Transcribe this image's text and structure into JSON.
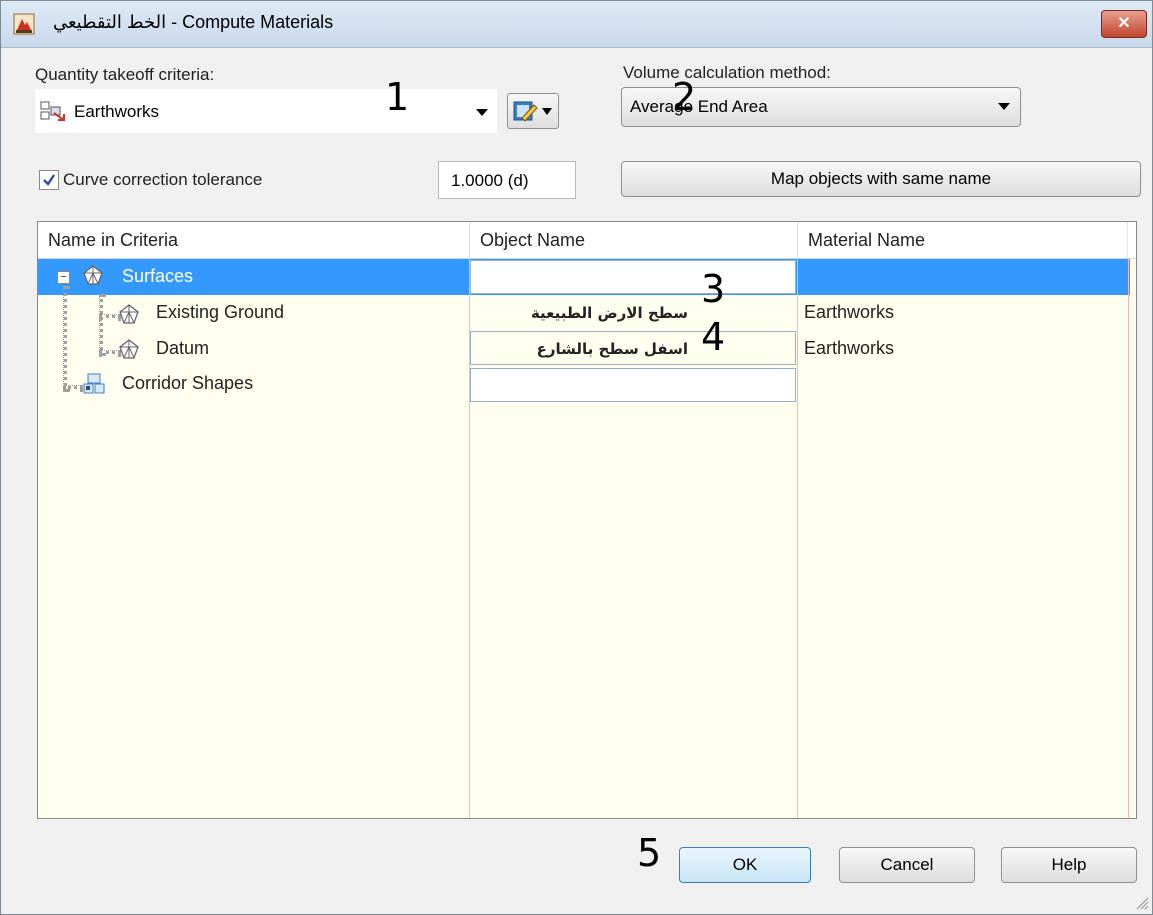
{
  "window": {
    "title": "الخط التقطيعي - Compute Materials",
    "close_label": "✕"
  },
  "criteria": {
    "label": "Quantity takeoff criteria:",
    "value": "Earthworks"
  },
  "volume": {
    "label": "Volume calculation method:",
    "value": "Average End Area"
  },
  "curve": {
    "checked": true,
    "label": "Curve correction tolerance",
    "value": "1.0000 (d)"
  },
  "map_button": "Map objects with same name",
  "grid": {
    "headers": [
      "Name in Criteria",
      "Object Name",
      "Material Name"
    ],
    "rows": [
      {
        "name": "Surfaces",
        "object": "",
        "material": ""
      },
      {
        "name": "Existing Ground",
        "object": "سطح الارض الطبيعية",
        "material": "Earthworks"
      },
      {
        "name": "Datum",
        "object": "اسفل سطح بالشارع",
        "material": "Earthworks"
      },
      {
        "name": "Corridor Shapes",
        "object": "",
        "material": ""
      }
    ]
  },
  "buttons": {
    "ok": "OK",
    "cancel": "Cancel",
    "help": "Help"
  },
  "annotations": [
    "1",
    "2",
    "3",
    "4",
    "5"
  ],
  "colors": {
    "selection": "#3399ff",
    "grid_background": "#fffff0",
    "close_button": "#c0442e"
  }
}
